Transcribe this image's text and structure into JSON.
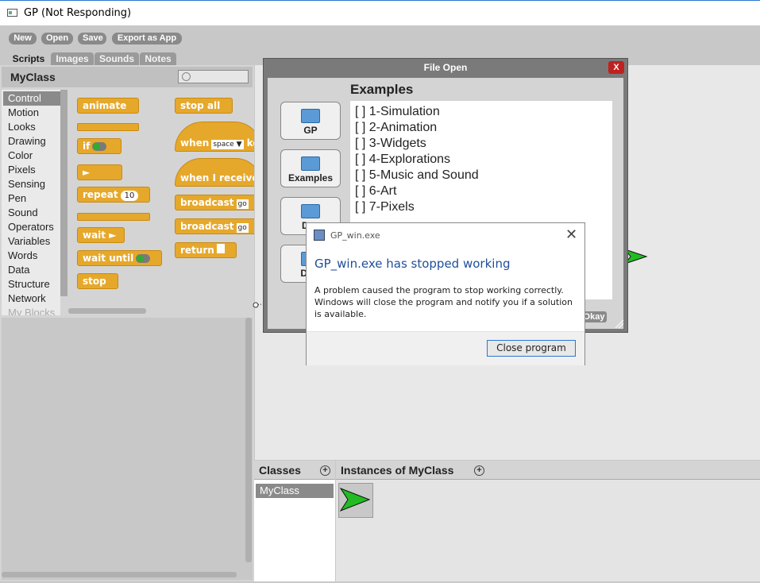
{
  "window": {
    "title": "GP (Not Responding)"
  },
  "toolbar": {
    "new": "New",
    "open": "Open",
    "save": "Save",
    "export": "Export as App"
  },
  "tabs": [
    "Scripts",
    "Images",
    "Sounds",
    "Notes"
  ],
  "class_panel": {
    "name": "MyClass",
    "search_placeholder": ""
  },
  "categories": [
    "Control",
    "Motion",
    "Looks",
    "Drawing",
    "Color",
    "Pixels",
    "Sensing",
    "Pen",
    "Sound",
    "Operators",
    "Variables",
    "Words",
    "Data",
    "Structure",
    "Network",
    "My Blocks"
  ],
  "blocks": {
    "animate": "animate",
    "if": "if",
    "repeat": "repeat",
    "repeat_count": "10",
    "wait": "wait",
    "wait_until": "wait until",
    "stop": "stop",
    "stop_all": "stop all",
    "when": "when",
    "when_key": "space",
    "when_tail": "ke",
    "when_receive": "when I receive",
    "broadcast1": "broadcast",
    "broadcast1_val": "go",
    "broadcast2": "broadcast",
    "broadcast2_val": "go",
    "return": "return"
  },
  "file_dialog": {
    "title": "File Open",
    "close": "X",
    "heading": "Examples",
    "sidebar": [
      "GP",
      "Examples",
      "Des",
      "Dow"
    ],
    "items": [
      "[ ] 1-Simulation",
      "[ ] 2-Animation",
      "[ ] 3-Widgets",
      "[ ] 4-Explorations",
      "[ ] 5-Music and Sound",
      "[ ] 6-Art",
      "[ ] 7-Pixels"
    ],
    "okay": "Okay"
  },
  "error_dialog": {
    "title": "GP_win.exe",
    "heading": "GP_win.exe has stopped working",
    "message": "A problem caused the program to stop working correctly. Windows will close the program and notify you if a solution is available.",
    "button": "Close program"
  },
  "bottom": {
    "classes_title": "Classes",
    "classes": [
      "MyClass"
    ],
    "instances_title": "Instances of MyClass"
  },
  "colors": {
    "block": "#e6a82b",
    "sprite": "#22bb22",
    "link": "#1e4e9a"
  }
}
